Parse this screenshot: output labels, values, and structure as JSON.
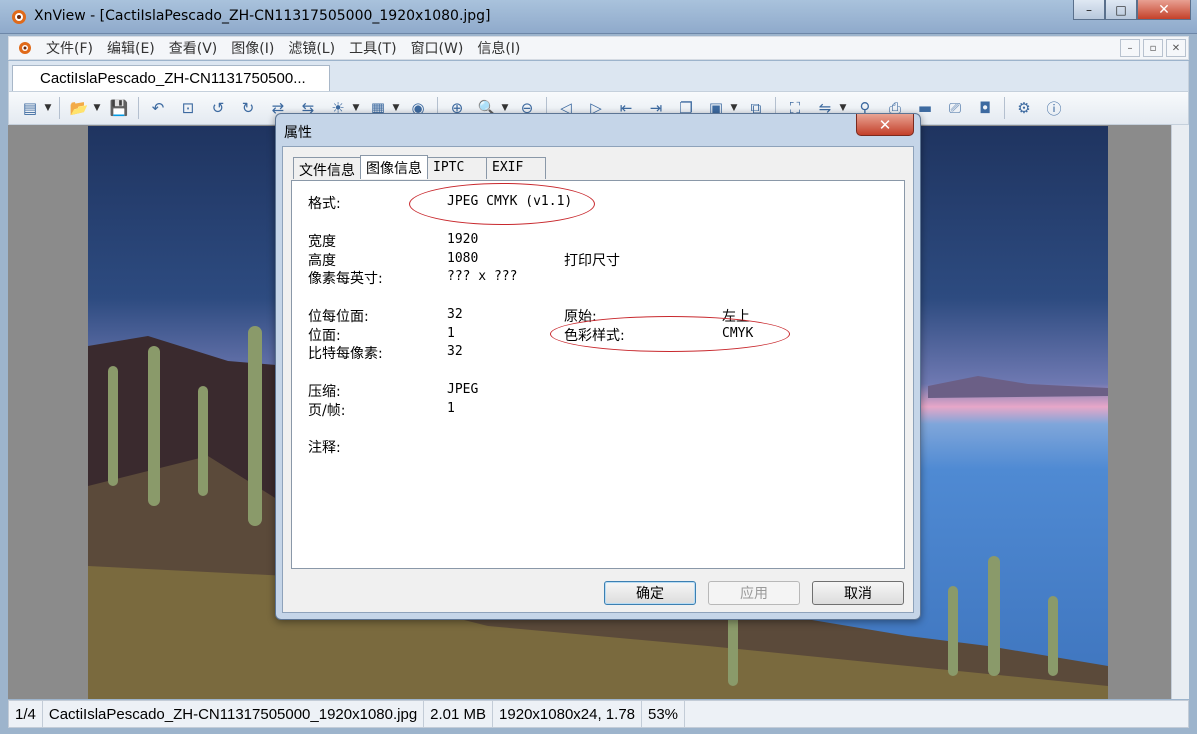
{
  "window": {
    "title": "XnView - [CactiIslaPescado_ZH-CN11317505000_1920x1080.jpg]",
    "minimize": "–",
    "maximize": "□",
    "close": "✕"
  },
  "menu": {
    "items": [
      "文件(F)",
      "编辑(E)",
      "查看(V)",
      "图像(I)",
      "滤镜(L)",
      "工具(T)",
      "窗口(W)",
      "信息(I)"
    ],
    "mdi": [
      "–",
      "▫",
      "✕"
    ]
  },
  "document_tab": "CactiIslaPescado_ZH-CN1131750500...",
  "statusbar": {
    "index": "1/4",
    "filename": "CactiIslaPescado_ZH-CN11317505000_1920x1080.jpg",
    "size": "2.01 MB",
    "dimensions": "1920x1080x24, 1.78",
    "zoom": "53%"
  },
  "dialog": {
    "title": "属性",
    "close": "✕",
    "tabs": [
      "文件信息",
      "图像信息",
      "IPTC",
      "EXIF"
    ],
    "fields": {
      "format_label": "格式:",
      "format_value": "JPEG CMYK (v1.1)",
      "width_label": "宽度",
      "width_value": "1920",
      "height_label": "高度",
      "height_value": "1080",
      "print_size_label": "打印尺寸",
      "dpi_label": "像素每英寸:",
      "dpi_value": "??? x ???",
      "bits_per_plane_label": "位每位面:",
      "bits_per_plane_value": "32",
      "planes_label": "位面:",
      "planes_value": "1",
      "bits_per_pixel_label": "比特每像素:",
      "bits_per_pixel_value": "32",
      "origin_label": "原始:",
      "origin_value": "左上",
      "color_mode_label": "色彩样式:",
      "color_mode_value": "CMYK",
      "compression_label": "压缩:",
      "compression_value": "JPEG",
      "pages_label": "页/帧:",
      "pages_value": "1",
      "comment_label": "注释:"
    },
    "buttons": {
      "ok": "确定",
      "apply": "应用",
      "cancel": "取消"
    }
  },
  "colors": {
    "annotation_ellipse": "#c8282d",
    "title_bar": "#a9c2dc"
  }
}
